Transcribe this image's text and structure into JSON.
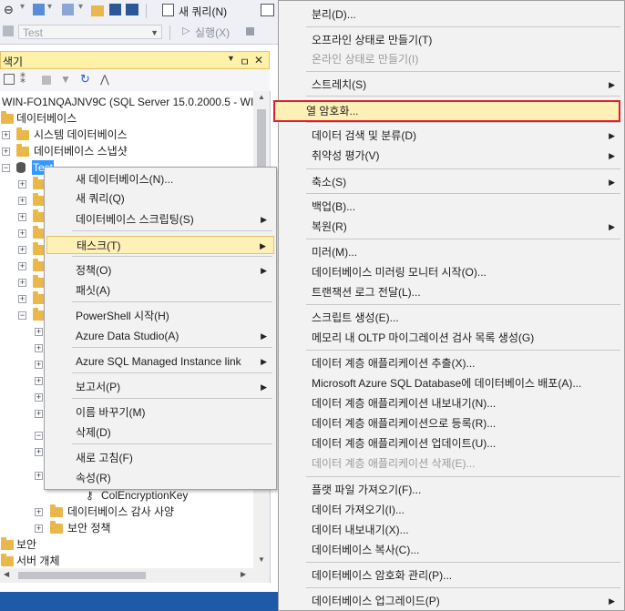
{
  "toolbar": {
    "new_query_label": "새 쿼리(N)",
    "database_combo": "Test",
    "execute_label": "실행(X)"
  },
  "object_explorer": {
    "title": "색기",
    "pin": "ㅁ",
    "close": "✕",
    "server_node": "WIN-FO1NQAJNV9C (SQL Server 15.0.2000.5 - WIN",
    "databases": "데이터베이스",
    "system_databases": "시스템 데이터베이스",
    "database_snapshots": "데이터베이스 스냅샷",
    "test_db": "Test",
    "col_encryption_key": "ColEncryptionKey",
    "db_audit_spec": "데이터베이스 감사 사양",
    "security_policy": "보안 정책",
    "security": "보안",
    "server_objects": "서버 개체"
  },
  "context_menu": {
    "items": [
      {
        "label": "새 데이터베이스(N)..."
      },
      {
        "label": "새 쿼리(Q)"
      },
      {
        "label": "데이터베이스 스크립팅(S)",
        "submenu": true
      },
      {
        "label": "태스크(T)",
        "submenu": true,
        "highlight": true
      },
      {
        "label": "정책(O)",
        "submenu": true
      },
      {
        "label": "패싯(A)"
      },
      {
        "label": "PowerShell 시작(H)"
      },
      {
        "label": "Azure Data Studio(A)",
        "submenu": true
      },
      {
        "label": "Azure SQL Managed Instance link",
        "submenu": true
      },
      {
        "label": "보고서(P)",
        "submenu": true
      },
      {
        "label": "이름 바꾸기(M)"
      },
      {
        "label": "삭제(D)"
      },
      {
        "label": "새로 고침(F)"
      },
      {
        "label": "속성(R)"
      }
    ]
  },
  "tasks_menu": {
    "items": [
      {
        "label": "분리(D)..."
      },
      {
        "label": "오프라인 상태로 만들기(T)"
      },
      {
        "label": "온라인 상태로 만들기(I)",
        "disabled": true
      },
      {
        "label": "스트레치(S)",
        "submenu": true
      },
      {
        "label": "열 암호화...",
        "selected": true
      },
      {
        "label": "데이터 검색 및 분류(D)",
        "submenu": true
      },
      {
        "label": "취약성 평가(V)",
        "submenu": true
      },
      {
        "label": "축소(S)",
        "submenu": true
      },
      {
        "label": "백업(B)..."
      },
      {
        "label": "복원(R)",
        "submenu": true
      },
      {
        "label": "미러(M)..."
      },
      {
        "label": "데이터베이스 미러링 모니터 시작(O)..."
      },
      {
        "label": "트랜잭션 로그 전달(L)..."
      },
      {
        "label": "스크립트 생성(E)..."
      },
      {
        "label": "메모리 내 OLTP 마이그레이션 검사 목록 생성(G)"
      },
      {
        "label": "데이터 계층 애플리케이션 추출(X)..."
      },
      {
        "label": "Microsoft Azure SQL Database에 데이터베이스 배포(A)..."
      },
      {
        "label": "데이터 계층 애플리케이션 내보내기(N)..."
      },
      {
        "label": "데이터 계층 애플리케이션으로 등록(R)..."
      },
      {
        "label": "데이터 계층 애플리케이션 업데이트(U)..."
      },
      {
        "label": "데이터 계층 애플리케이션 삭제(E)...",
        "disabled": true
      },
      {
        "label": "플랫 파일 가져오기(F)..."
      },
      {
        "label": "데이터 가져오기(I)..."
      },
      {
        "label": "데이터 내보내기(X)..."
      },
      {
        "label": "데이터베이스 복사(C)..."
      },
      {
        "label": "데이터베이스 암호화 관리(P)..."
      },
      {
        "label": "데이터베이스 업그레이드(P)",
        "submenu": true
      }
    ]
  },
  "colors": {
    "highlight": "#fff0b8",
    "selection_border": "#e0202a",
    "folder": "#e9b74a",
    "status_bar": "#1e5aa8"
  }
}
